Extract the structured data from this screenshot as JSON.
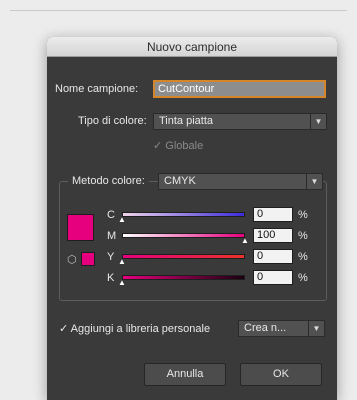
{
  "dialog": {
    "title": "Nuovo campione",
    "name_label": "Nome campione:",
    "name_value": "CutContour",
    "color_type_label": "Tipo di colore:",
    "color_type_value": "Tinta piatta",
    "global_label": "Globale",
    "global_checked": true,
    "color_mode_label": "Metodo colore:",
    "color_mode_value": "CMYK",
    "swatch_color": "#e6007e",
    "channels": [
      {
        "key": "c",
        "label": "C",
        "value": "0",
        "percent": "%",
        "level": 0,
        "gradient": "linear-gradient(to right,#f0d4ea,#3a2cd8)"
      },
      {
        "key": "m",
        "label": "M",
        "value": "100",
        "percent": "%",
        "level": 100,
        "gradient": "linear-gradient(to right,#ffffff,#e6007e)"
      },
      {
        "key": "y",
        "label": "Y",
        "value": "0",
        "percent": "%",
        "level": 0,
        "gradient": "linear-gradient(to right,#e6007e,#e8332a)"
      },
      {
        "key": "k",
        "label": "K",
        "value": "0",
        "percent": "%",
        "level": 0,
        "gradient": "linear-gradient(to right,#e6007e,#1a0010)"
      }
    ],
    "add_library_label": "Aggiungi a libreria personale",
    "add_library_checked": true,
    "library_select_value": "Crea n...",
    "cancel_label": "Annulla",
    "ok_label": "OK"
  },
  "colors": {
    "accent_focus": "#d4872a",
    "magenta": "#e6007e",
    "dialog_bg": "#3a3a3a"
  },
  "icons": {
    "check": "✓",
    "dropdown": "▼",
    "slider_thumb": "▲",
    "gamut": "⬡"
  }
}
